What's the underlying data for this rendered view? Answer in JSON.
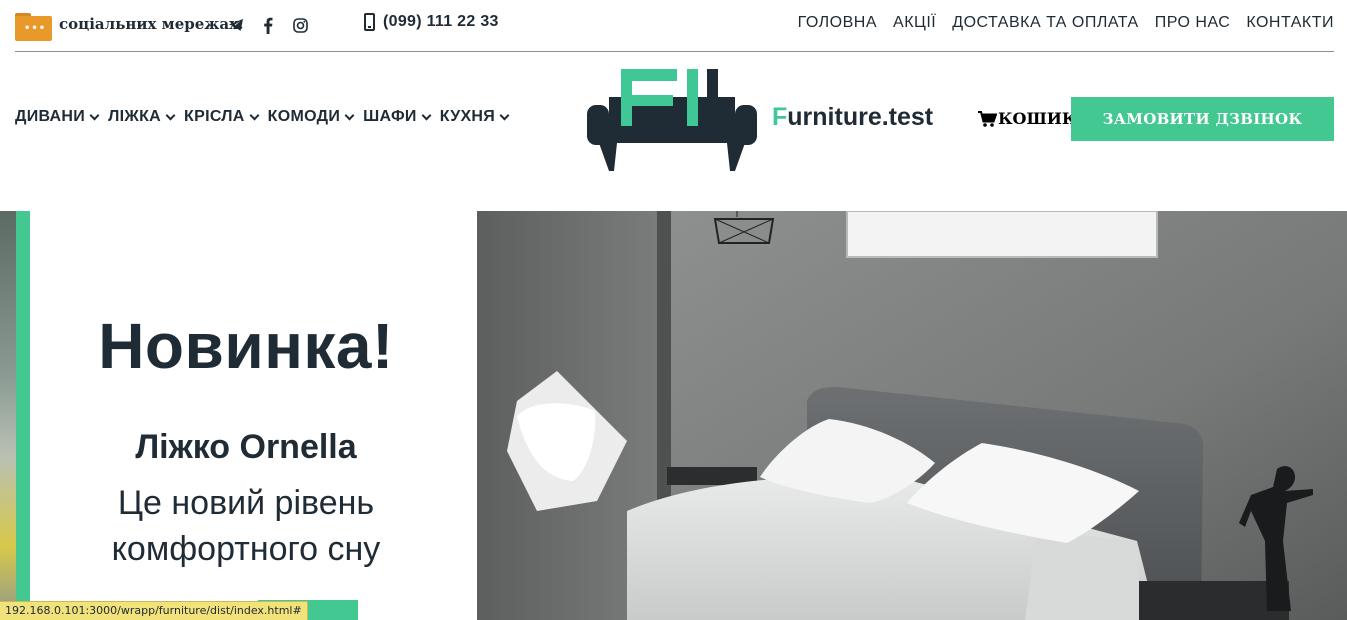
{
  "topbar": {
    "social_label": "соціальних мережах:",
    "social_icons": [
      "telegram-icon",
      "facebook-icon",
      "instagram-icon"
    ],
    "phone": "(099) 111 22 33",
    "nav": [
      "ГОЛОВНА",
      "АКЦІЇ",
      "ДОСТАВКА ТА ОПЛАТА",
      "ПРО НАС",
      "КОНТАКТИ"
    ]
  },
  "categories": [
    "ДИВАНИ",
    "ЛІЖКА",
    "КРІСЛА",
    "КОМОДИ",
    "ШАФИ",
    "КУХНЯ"
  ],
  "brand": {
    "accent_letter": "F",
    "rest": "urniture.test"
  },
  "cart": {
    "label": "КОШИК"
  },
  "callback_button": "ЗАМОВИТИ ДЗВІНОК",
  "hero": {
    "title": "Новинка!",
    "product": "Ліжко Ornella",
    "line1": "Це новий рівень",
    "line2": "комфортного сну"
  },
  "status_url": "192.168.0.101:3000/wrapp/furniture/dist/index.html#",
  "colors": {
    "accent": "#43c892",
    "dark": "#1f2b35",
    "folder": "#e8992a"
  }
}
